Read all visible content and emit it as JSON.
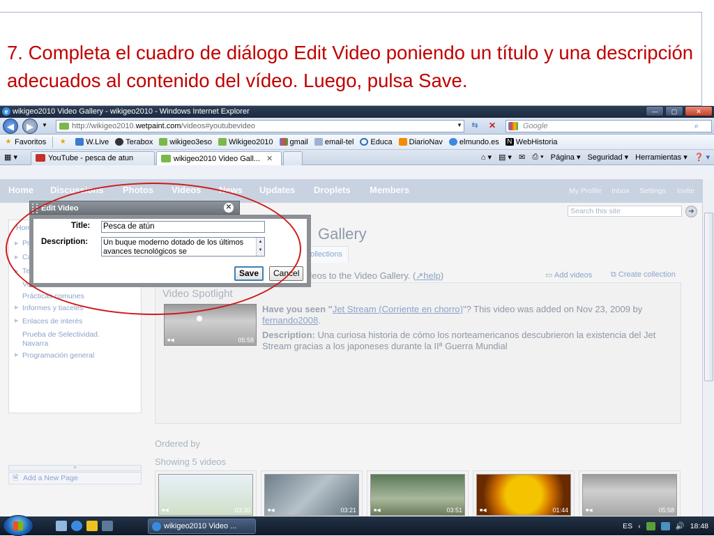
{
  "slide": {
    "instruction": "7. Completa el cuadro de diálogo Edit Video poniendo un título y una descripción adecuados al contenido del vídeo. Luego, pulsa Save."
  },
  "browser": {
    "window_title": "wikigeo2010 Video Gallery - wikigeo2010 - Windows Internet Explorer",
    "url_prefix": "http://wikigeo2010.",
    "url_host": "wetpaint.com",
    "url_suffix": "/videos#youtubevideo",
    "search_placeholder": "Google",
    "favorites_label": "Favoritos",
    "favorites": [
      "W.Live",
      "Terabox",
      "wikigeo3eso",
      "Wikigeo2010",
      "gmail",
      "email-tel",
      "Educa",
      "DiarioNav",
      "elmundo.es",
      "WebHistoria"
    ],
    "tabs": [
      {
        "label": "YouTube - pesca de atun"
      },
      {
        "label": "wikigeo2010 Video Gall..."
      }
    ],
    "command_bar": {
      "page": "Página",
      "security": "Seguridad",
      "tools": "Herramientas"
    }
  },
  "site": {
    "nav": [
      "Home",
      "Discussions",
      "Photos",
      "Videos",
      "News",
      "Updates",
      "Droplets",
      "Members"
    ],
    "nav_right": [
      "My Profile",
      "Inbox",
      "Settings",
      "Invite"
    ],
    "search_placeholder": "Search this site",
    "sidebar_items": [
      "Home",
      "Pre",
      "Cal",
      "Ter",
      "Voc",
      "Prácticas comunes",
      "Informes y tiaceles",
      "Enlaces de interés",
      "Prueba de Selectividad. Navarra",
      "Programación general"
    ],
    "sidebar_footer": "Add a New Page",
    "gallery_title": "Gallery",
    "collections_tab": "ollections",
    "intro_text": "deos to the Video Gallery. (",
    "help_link": "help",
    "intro_end": ")",
    "add_videos": "Add videos",
    "create_collection": "Create collection",
    "spotlight": {
      "heading": "Video Spotlight",
      "have_you_seen": "Have you seen \"",
      "video_link": "Jet Stream (Corriente en chorro)",
      "added_text": "\"? This video was added on Nov 23, 2009 by ",
      "author": "fernando2008",
      "period": ".",
      "description_label": "Description:",
      "description": " Una curiosa historia de cómo los norteamericanos descubrieron la existencia del Jet Stream gracias a los japoneses durante la IIª Guerra Mundial",
      "duration": "05:58"
    },
    "ordered_by": "Ordered by",
    "showing": "Showing 5 videos",
    "thumb_durations": [
      "03:30",
      "03:21",
      "03:51",
      "01:44",
      "05:58"
    ]
  },
  "dialog": {
    "title": "Edit Video",
    "title_label": "Title:",
    "title_value": "Pesca de atún",
    "description_label": "Description:",
    "description_value": "Un buque moderno dotado de los últimos avances tecnológicos se",
    "save": "Save",
    "cancel": "Cancel"
  },
  "taskbar": {
    "task": "wikigeo2010 Video ...",
    "lang": "ES",
    "time": "18:48"
  }
}
